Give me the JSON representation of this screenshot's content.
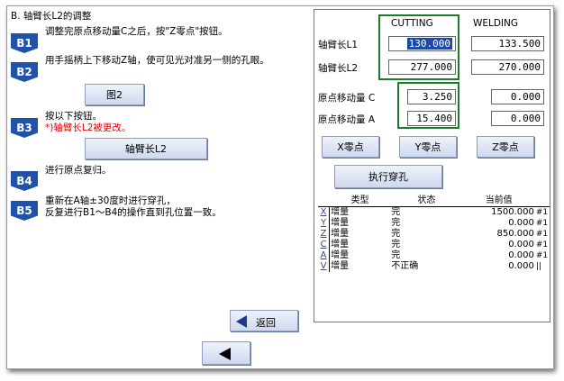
{
  "title": "B. 轴臂长L2的调整",
  "steps": [
    {
      "badge": "B1",
      "text": "调整完原点移动量C之后，按\"Z零点\"按钮。"
    },
    {
      "badge": "B2",
      "text": "用手摇柄上下移动Z轴，使可见光对准另一侧的孔眼。"
    },
    {
      "badge": "B3",
      "text": "按以下按钮。",
      "warning": "*)轴臂长L2被更改。"
    },
    {
      "badge": "B4",
      "text": "进行原点复归。"
    },
    {
      "badge": "B5",
      "text": "重新在A轴±30度时进行穿孔，",
      "text2": "反复进行B1～B4的操作直到孔位置一致。"
    }
  ],
  "buttons": {
    "fig2": "图2",
    "arm_l2": "轴臂长L2",
    "back": "返回",
    "x_zero": "X零点",
    "y_zero": "Y零点",
    "z_zero": "Z零点",
    "exec_pierce": "执行穿孔"
  },
  "right": {
    "col_cutting": "CUTTING",
    "col_welding": "WELDING",
    "row_l1": "轴臂长L1",
    "row_l2": "轴臂长L2",
    "row_c": "原点移动量  C",
    "row_a": "原点移动量  A",
    "l1_cutting": "130.000",
    "l1_welding": "133.500",
    "l2_cutting": "277.000",
    "l2_welding": "270.000",
    "c_cutting": "3.250",
    "c_welding": "0.000",
    "a_cutting": "15.400",
    "a_welding": "0.000"
  },
  "table": {
    "headers": [
      "类型",
      "状态",
      "当前值"
    ],
    "rows": [
      {
        "axis": "X",
        "type": "增量",
        "state": "完",
        "value": "1500.000",
        "tail": "#1"
      },
      {
        "axis": "Y",
        "type": "增量",
        "state": "完",
        "value": "0.000",
        "tail": "#1"
      },
      {
        "axis": "Z",
        "type": "增量",
        "state": "完",
        "value": "850.000",
        "tail": "#1"
      },
      {
        "axis": "C",
        "type": "增量",
        "state": "完",
        "value": "0.000",
        "tail": "#1"
      },
      {
        "axis": "A",
        "type": "增量",
        "state": "完",
        "value": "0.000",
        "tail": "#1"
      },
      {
        "axis": "V",
        "type": "增量",
        "state": "不正确",
        "value": "0.000",
        "tail": "||"
      }
    ]
  },
  "colors": {
    "badge": "#1f52a8",
    "highlight": "#1d7a2a",
    "warning": "#e00000",
    "selection": "#1e4aa6"
  }
}
